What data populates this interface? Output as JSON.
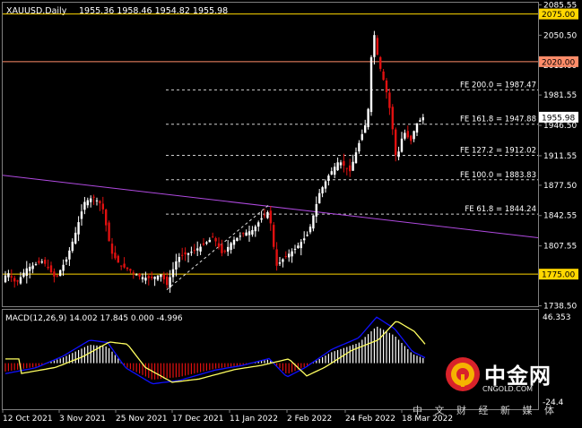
{
  "chart_data": {
    "type": "candlestick",
    "header": "XAUUSD,Daily",
    "ohlc_text": "1955.36 1958.46 1954.82 1955.98",
    "ylim": [
      1738.0,
      2088.0
    ],
    "y_ticks": [
      "2085.55",
      "2050.50",
      "2015.60",
      "1981.55",
      "1946.50",
      "1911.55",
      "1877.50",
      "1842.55",
      "1807.55",
      "1773.50",
      "1738.50"
    ],
    "current_price": "1955.98",
    "current_value": 1955.98,
    "x_labels": [
      "12 Oct 2021",
      "3 Nov 2021",
      "25 Nov 2021",
      "17 Dec 2021",
      "11 Jan 2022",
      "2 Feb 2022",
      "24 Feb 2022",
      "18 Mar 2022"
    ],
    "levels": [
      {
        "label": "2075.00",
        "value": 2075.0,
        "color": "#ffd700"
      },
      {
        "label": "2020.00",
        "value": 2020.0,
        "color": "#ff8c69"
      },
      {
        "label": "1775.00",
        "value": 1775.0,
        "color": "#ffd700"
      }
    ],
    "fibo": [
      {
        "label": "FE 200.0 = 1987.47",
        "value": 1987.47
      },
      {
        "label": "FE 161.8 = 1947.88",
        "value": 1947.88
      },
      {
        "label": "FE 127.2 = 1912.02",
        "value": 1912.02
      },
      {
        "label": "FE 100.0 = 1883.83",
        "value": 1883.83
      },
      {
        "label": "FE 61.8 = 1844.24",
        "value": 1844.24
      }
    ],
    "trendline": {
      "from_value": 1889.0,
      "to_value": 1817.0,
      "color": "#b04ae0"
    },
    "dashed_trend": {
      "from_value": 1757.0,
      "to_value": 1855.0
    },
    "macd": {
      "label": "MACD(12,26,9) 14.002 17.845 0.000 -4.996",
      "ylim": [
        -40.0,
        46.353
      ],
      "top_tick": "46.353",
      "bottom_tick": "-24.4"
    },
    "watermark": {
      "name": "中金网",
      "url": "CNGOLD.COM",
      "tagline": "中 文 财 经 新 媒 体"
    },
    "colors": {
      "up": "#ffffff",
      "down": "#e01010",
      "macd_main": "#1010ff",
      "macd_signal": "#ffff60",
      "grid_text": "#ffffff"
    }
  }
}
